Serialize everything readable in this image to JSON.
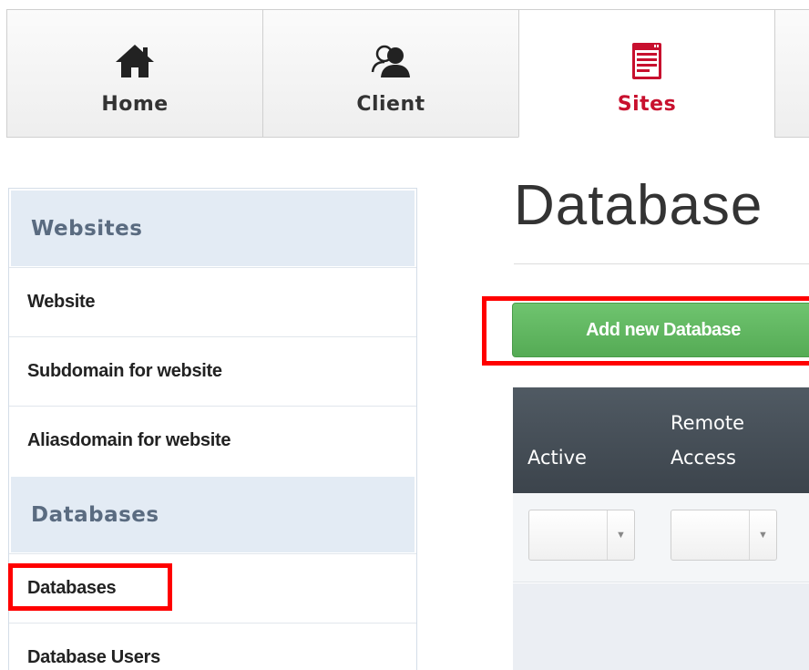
{
  "nav": {
    "tabs": [
      {
        "label": "Home",
        "icon": "home-icon"
      },
      {
        "label": "Client",
        "icon": "client-users-icon"
      },
      {
        "label": "Sites",
        "icon": "sites-browser-icon",
        "active": true
      }
    ],
    "active_color": "#c8102e"
  },
  "sidebar": {
    "sections": [
      {
        "header": "Websites",
        "items": [
          "Website",
          "Subdomain for website",
          "Aliasdomain for website"
        ]
      },
      {
        "header": "Databases",
        "items": [
          "Databases",
          "Database Users"
        ]
      }
    ]
  },
  "main": {
    "title": "Database",
    "add_button": "Add new Database",
    "table": {
      "columns": [
        {
          "line1": "Active",
          "line2": ""
        },
        {
          "line1": "Remote",
          "line2": "Access"
        }
      ],
      "filters": [
        "",
        ""
      ]
    }
  },
  "colors": {
    "button_green": "#5cb85c",
    "table_header": "#464e56",
    "highlight": "#ff0000",
    "sidebar_header_bg": "#e3ebf4"
  }
}
